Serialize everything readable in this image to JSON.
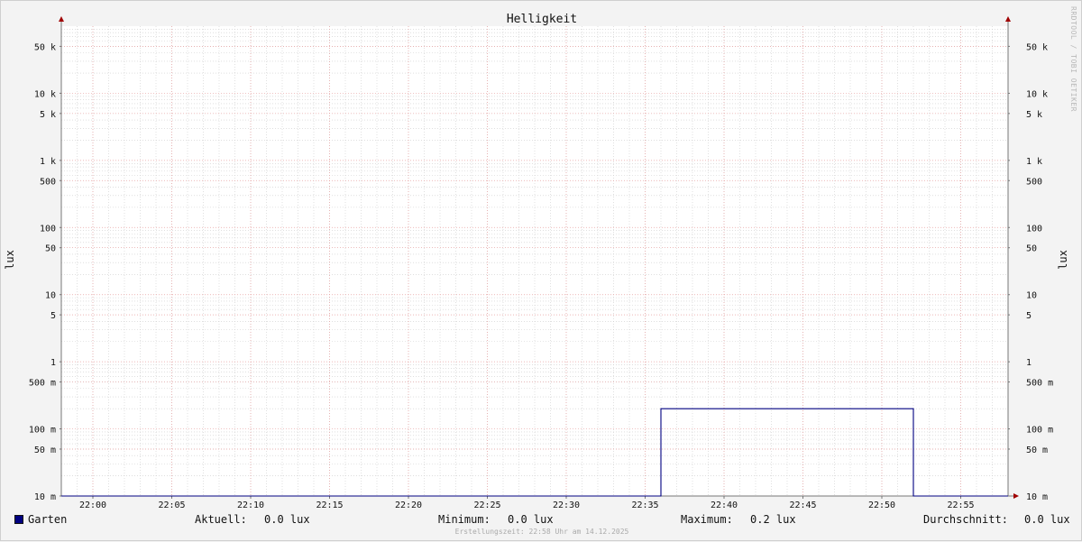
{
  "chart_data": {
    "type": "line",
    "title": "Helligkeit",
    "ylabel": "lux",
    "yscale": "log",
    "ylim": [
      0.01,
      100000
    ],
    "y_ticks": [
      {
        "value": 0.01,
        "label": "10 m"
      },
      {
        "value": 0.05,
        "label": "50 m"
      },
      {
        "value": 0.1,
        "label": "100 m"
      },
      {
        "value": 0.5,
        "label": "500 m"
      },
      {
        "value": 1,
        "label": "1"
      },
      {
        "value": 5,
        "label": "5"
      },
      {
        "value": 10,
        "label": "10"
      },
      {
        "value": 50,
        "label": "50"
      },
      {
        "value": 100,
        "label": "100"
      },
      {
        "value": 500,
        "label": "500"
      },
      {
        "value": 1000,
        "label": "1 k"
      },
      {
        "value": 5000,
        "label": "5 k"
      },
      {
        "value": 10000,
        "label": "10 k"
      },
      {
        "value": 50000,
        "label": "50 k"
      }
    ],
    "xlim": [
      "21:58",
      "22:58"
    ],
    "x_ticks": [
      "22:00",
      "22:05",
      "22:10",
      "22:15",
      "22:20",
      "22:25",
      "22:30",
      "22:35",
      "22:40",
      "22:45",
      "22:50",
      "22:55"
    ],
    "grid": true,
    "series": [
      {
        "name": "Garten",
        "color": "#000080",
        "points": [
          {
            "x": "21:58",
            "y": 0.01
          },
          {
            "x": "22:36",
            "y": 0.01
          },
          {
            "x": "22:36",
            "y": 0.2
          },
          {
            "x": "22:52",
            "y": 0.2
          },
          {
            "x": "22:52",
            "y": 0.01
          },
          {
            "x": "22:58",
            "y": 0.01
          }
        ]
      }
    ]
  },
  "legend": {
    "series_name": "Garten",
    "current_label": "Aktuell:",
    "current_value": "0.0 lux",
    "min_label": "Minimum:",
    "min_value": "0.0 lux",
    "max_label": "Maximum:",
    "max_value": "0.2 lux",
    "avg_label": "Durchschnitt:",
    "avg_value": "0.0 lux"
  },
  "footer": "Erstellungszeit: 22:58 Uhr am 14.12.2025",
  "side_credit": "RRDTOOL / TOBI OETIKER",
  "colors": {
    "background": "#f3f3f3",
    "plot_background": "#ffffff",
    "major_grid": "#e8a0a0",
    "minor_grid": "#cccccc",
    "axis": "#777777",
    "arrow": "#a00000"
  }
}
